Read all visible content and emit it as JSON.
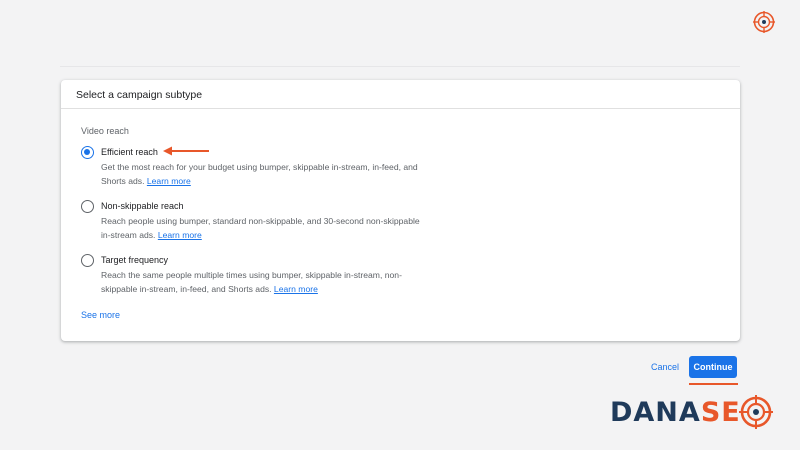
{
  "card": {
    "title": "Select a campaign subtype",
    "section_label": "Video reach",
    "options": [
      {
        "title": "Efficient reach",
        "description": "Get the most reach for your budget using bumper, skippable in-stream, in-feed, and Shorts ads.",
        "link": "Learn more",
        "selected": true
      },
      {
        "title": "Non-skippable reach",
        "description": "Reach people using bumper, standard non-skippable, and 30-second non-skippable in-stream ads.",
        "link": "Learn more",
        "selected": false
      },
      {
        "title": "Target frequency",
        "description": "Reach the same people multiple times using bumper, skippable in-stream, non-skippable in-stream, in-feed, and Shorts ads.",
        "link": "Learn more",
        "selected": false
      }
    ],
    "see_more": "See more"
  },
  "actions": {
    "cancel": "Cancel",
    "continue": "Continue"
  },
  "logo": {
    "text_dark": "DANA",
    "text_accent": "SE"
  },
  "colors": {
    "accent_blue": "#1a73e8",
    "annotation_orange": "#e8572a",
    "logo_navy": "#1f3a5a"
  },
  "icons": {
    "top_right": "target-icon",
    "annotation": "arrow-left-icon"
  }
}
